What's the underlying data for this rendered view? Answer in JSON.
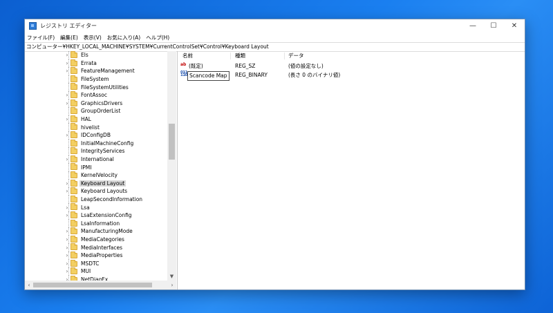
{
  "window": {
    "title": "レジストリ エディター"
  },
  "controls": {
    "minimize": "—",
    "maximize": "☐",
    "close": "✕"
  },
  "menu": [
    "ファイル(F)",
    "編集(E)",
    "表示(V)",
    "お気に入り(A)",
    "ヘルプ(H)"
  ],
  "address": "コンピューター¥HKEY_LOCAL_MACHINE¥SYSTEM¥CurrentControlSet¥Control¥Keyboard Layout",
  "tree": {
    "items": [
      {
        "label": "Els",
        "expandable": true
      },
      {
        "label": "Errata",
        "expandable": true
      },
      {
        "label": "FeatureManagement",
        "expandable": true
      },
      {
        "label": "FileSystem",
        "expandable": false
      },
      {
        "label": "FileSystemUtilities",
        "expandable": false
      },
      {
        "label": "FontAssoc",
        "expandable": true
      },
      {
        "label": "GraphicsDrivers",
        "expandable": true
      },
      {
        "label": "GroupOrderList",
        "expandable": false
      },
      {
        "label": "HAL",
        "expandable": true
      },
      {
        "label": "hivelist",
        "expandable": false
      },
      {
        "label": "IDConfigDB",
        "expandable": true
      },
      {
        "label": "InitialMachineConfig",
        "expandable": false
      },
      {
        "label": "IntegrityServices",
        "expandable": false
      },
      {
        "label": "International",
        "expandable": true
      },
      {
        "label": "IPMI",
        "expandable": false
      },
      {
        "label": "KernelVelocity",
        "expandable": false
      },
      {
        "label": "Keyboard Layout",
        "expandable": true,
        "selected": true
      },
      {
        "label": "Keyboard Layouts",
        "expandable": true
      },
      {
        "label": "LeapSecondInformation",
        "expandable": false
      },
      {
        "label": "Lsa",
        "expandable": true
      },
      {
        "label": "LsaExtensionConfig",
        "expandable": true
      },
      {
        "label": "LsaInformation",
        "expandable": false
      },
      {
        "label": "ManufacturingMode",
        "expandable": true
      },
      {
        "label": "MediaCategories",
        "expandable": true
      },
      {
        "label": "MediaInterfaces",
        "expandable": true
      },
      {
        "label": "MediaProperties",
        "expandable": true
      },
      {
        "label": "MSDTC",
        "expandable": true
      },
      {
        "label": "MUI",
        "expandable": true
      },
      {
        "label": "NetDiagFx",
        "expandable": true
      }
    ]
  },
  "list": {
    "headers": {
      "name": "名前",
      "type": "種類",
      "data": "データ"
    },
    "rows": [
      {
        "name": "(既定)",
        "type": "REG_SZ",
        "data": "(値の設定なし)",
        "icon": "string-value-icon"
      },
      {
        "name": "Scancode Map",
        "type": "REG_BINARY",
        "data": "(長さ 0 のバイナリ値)",
        "icon": "binary-value-icon",
        "editing": true
      }
    ]
  }
}
